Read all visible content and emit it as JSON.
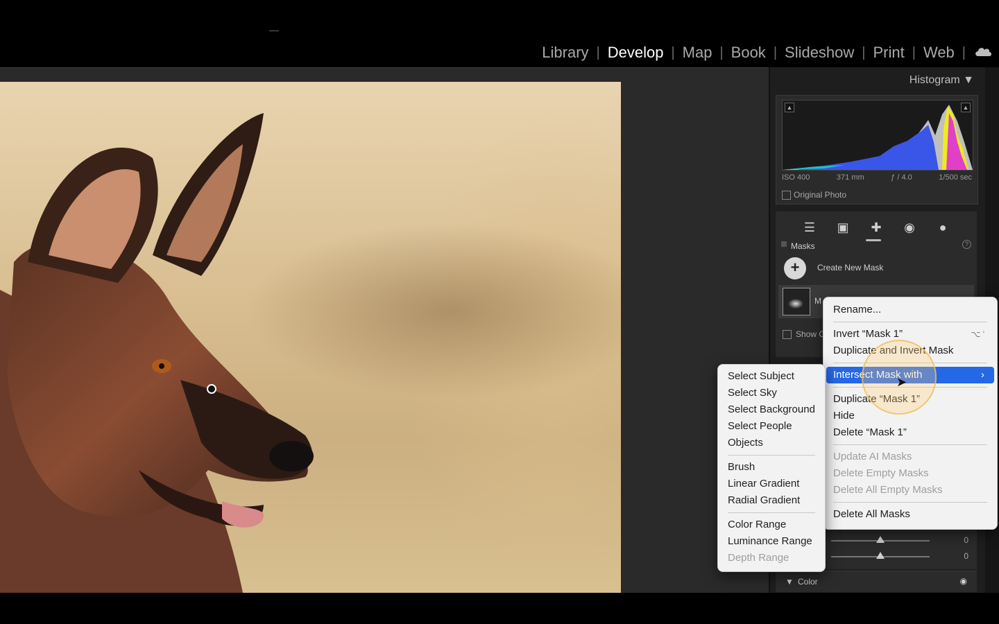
{
  "modules": {
    "items": [
      "Library",
      "Develop",
      "Map",
      "Book",
      "Slideshow",
      "Print",
      "Web"
    ],
    "active": "Develop",
    "separator": "|"
  },
  "histogram": {
    "title": "Histogram",
    "exif": {
      "iso": "ISO 400",
      "focal": "371 mm",
      "aperture": "ƒ / 4.0",
      "shutter": "1/500 sec"
    },
    "original_photo_label": "Original Photo"
  },
  "masks": {
    "title": "Masks",
    "create_label": "Create New Mask",
    "mask_initial": "M",
    "show_label": "Show C"
  },
  "sliders": {
    "values": [
      "0",
      "0"
    ]
  },
  "color_section": {
    "label": "Color"
  },
  "context_menu": {
    "rename": "Rename...",
    "invert": "Invert “Mask 1”",
    "invert_shortcut": "⌥ '",
    "duplicate_invert": "Duplicate and Invert Mask",
    "intersect": "Intersect Mask with",
    "duplicate": "Duplicate “Mask 1”",
    "hide": "Hide",
    "delete": "Delete “Mask 1”",
    "update_ai": "Update AI Masks",
    "delete_empty": "Delete Empty Masks",
    "delete_all_empty": "Delete All Empty Masks",
    "delete_all": "Delete All Masks"
  },
  "submenu": {
    "select_subject": "Select Subject",
    "select_sky": "Select Sky",
    "select_background": "Select Background",
    "select_people": "Select People",
    "objects": "Objects",
    "brush": "Brush",
    "linear_gradient": "Linear Gradient",
    "radial_gradient": "Radial Gradient",
    "color_range": "Color Range",
    "luminance_range": "Luminance Range",
    "depth_range": "Depth Range"
  },
  "colors": {
    "accent": "#2468e8",
    "panel": "#2b2b2b",
    "menu_bg": "#f2f2f2"
  }
}
